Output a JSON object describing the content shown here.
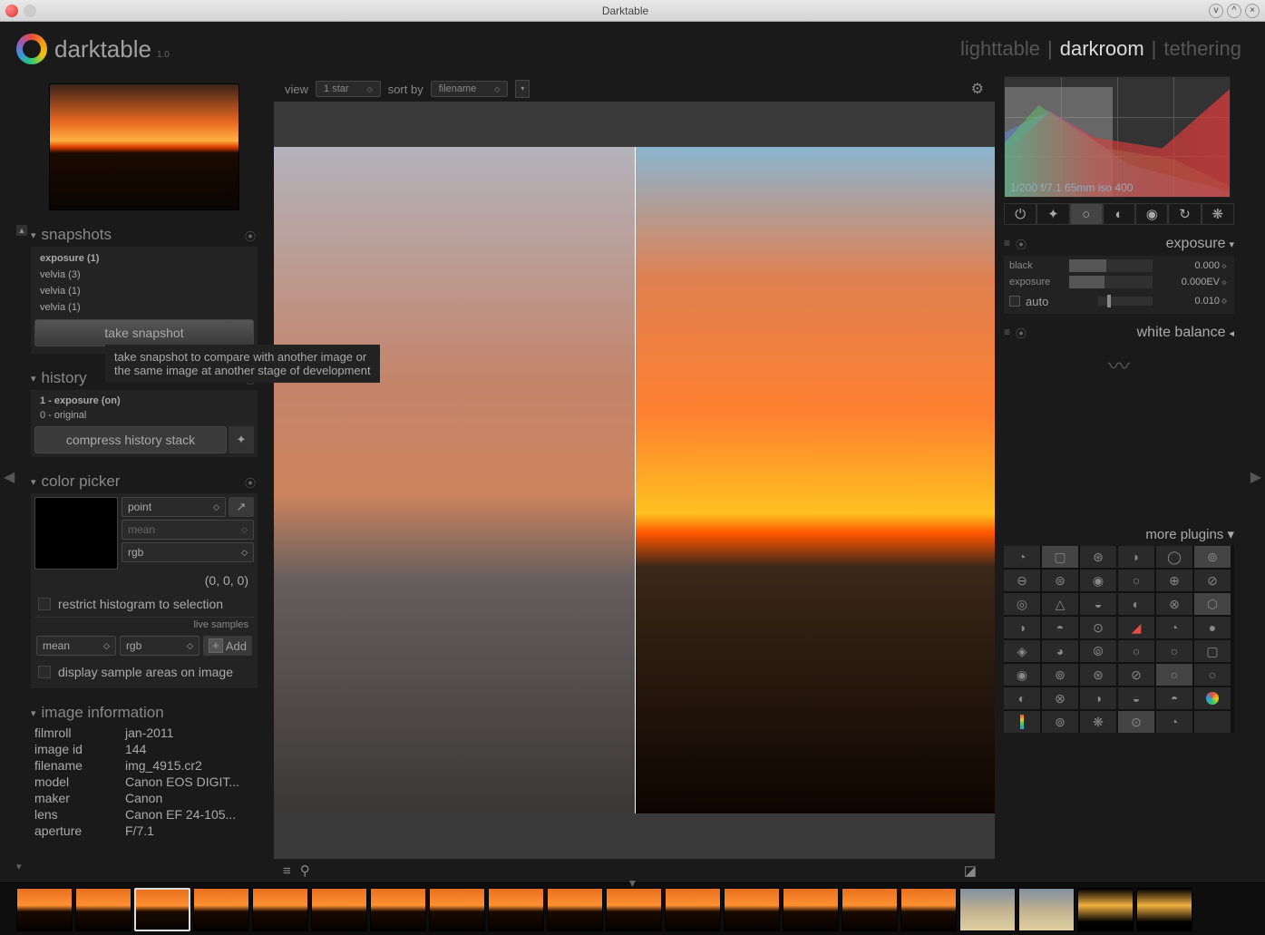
{
  "window": {
    "title": "Darktable"
  },
  "app": {
    "name": "darktable",
    "version": "1.0"
  },
  "nav": {
    "lighttable": "lighttable",
    "darkroom": "darkroom",
    "tethering": "tethering",
    "sep": "|"
  },
  "center_toolbar": {
    "view_label": "view",
    "view_value": "1 star",
    "sort_label": "sort by",
    "sort_value": "filename"
  },
  "tooltip": {
    "line1": "take snapshot to compare with another image or",
    "line2": "the same image at another stage of development"
  },
  "left": {
    "snapshots": {
      "title": "snapshots",
      "items": [
        "exposure (1)",
        "velvia (3)",
        "velvia (1)",
        "velvia (1)"
      ],
      "take": "take snapshot"
    },
    "history": {
      "title": "history",
      "items": [
        "1 - exposure (on)",
        "0 - original"
      ],
      "compress": "compress history stack"
    },
    "picker": {
      "title": "color picker",
      "point": "point",
      "mean": "mean",
      "rgb": "rgb",
      "val": "(0, 0, 0)",
      "restrict": "restrict histogram to selection",
      "live": "live samples",
      "sample_mean": "mean",
      "sample_rgb": "rgb",
      "add": "Add",
      "display": "display sample areas on image"
    },
    "info": {
      "title": "image information",
      "rows": [
        {
          "k": "filmroll",
          "v": "jan-2011"
        },
        {
          "k": "image id",
          "v": "144"
        },
        {
          "k": "filename",
          "v": "img_4915.cr2"
        },
        {
          "k": "model",
          "v": "Canon EOS DIGIT..."
        },
        {
          "k": "maker",
          "v": "Canon"
        },
        {
          "k": "lens",
          "v": "Canon EF 24-105..."
        },
        {
          "k": "aperture",
          "v": "F/7.1"
        }
      ]
    }
  },
  "right": {
    "hist_info": "1/200 f/7.1 65mm iso 400",
    "exposure": {
      "title": "exposure",
      "black_label": "black",
      "black_val": "0.000",
      "exp_label": "exposure",
      "exp_val": "0.000EV",
      "auto_label": "auto",
      "auto_val": "0.010"
    },
    "white_balance": {
      "title": "white balance"
    },
    "more": "more plugins"
  }
}
